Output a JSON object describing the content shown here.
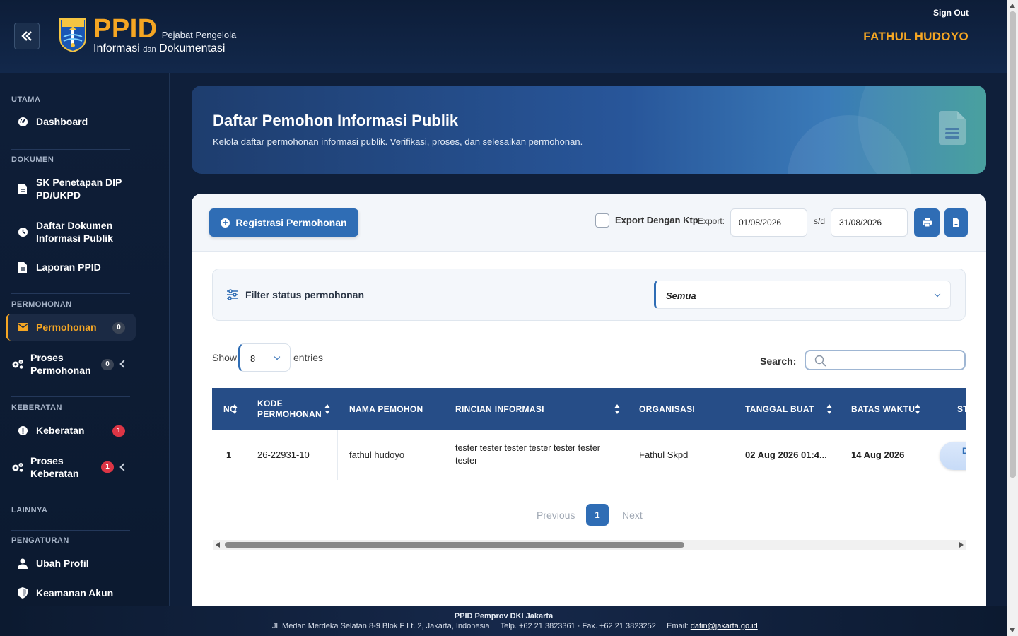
{
  "header": {
    "collapse_icon": "double-chevron-left-icon",
    "logo_ppid": "PPID",
    "logo_sub1": "Pejabat Pengelola",
    "logo_line2_a": "Informasi",
    "logo_line2_b": "dan",
    "logo_line2_c": "Dokumentasi",
    "signout": "Sign Out",
    "username": "FATHUL HUDOYO"
  },
  "sidebar": {
    "sections": {
      "utama": "UTAMA",
      "dokumen": "DOKUMEN",
      "permohonan": "PERMOHONAN",
      "keberatan": "KEBERATAN",
      "lainnya": "LAINNYA",
      "pengaturan": "PENGATURAN"
    },
    "items": {
      "dashboard": "Dashboard",
      "sk_penetapan": "SK Penetapan DIP PD/UKPD",
      "daftar_dokumen": "Daftar Dokumen Informasi Publik",
      "laporan": "Laporan PPID",
      "permohonan": "Permohonan",
      "proses_permohonan": "Proses Permohonan",
      "keberatan": "Keberatan",
      "proses_keberatan": "Proses Keberatan",
      "ubah_profil": "Ubah Profil",
      "keamanan_akun": "Keamanan Akun"
    },
    "badges": {
      "permohonan": "0",
      "proses_permohonan": "0",
      "keberatan": "1",
      "proses_keberatan": "1"
    }
  },
  "hero": {
    "title": "Daftar Pemohon Informasi Publik",
    "subtitle": "Kelola daftar permohonan informasi publik. Verifikasi, proses, dan selesaikan permohonan."
  },
  "toolbar": {
    "register_label": "Registrasi Permohonan",
    "export_ktp_label": "Export Dengan Ktp",
    "export_label": "Export:",
    "date_from": "01/08/2026",
    "date_sep": "s/d",
    "date_to": "31/08/2026"
  },
  "filter": {
    "label": "Filter status permohonan",
    "selected": "Semua"
  },
  "table_controls": {
    "show_label": "Show",
    "page_size": "8",
    "entries_label": "entries",
    "search_label": "Search:",
    "search_value": ""
  },
  "table": {
    "columns": [
      "NO",
      "KODE PERMOHONAN",
      "NAMA PEMOHON",
      "RINCIAN INFORMASI",
      "ORGANISASI",
      "TANGGAL BUAT",
      "BATAS WAKTU",
      "ST"
    ],
    "rows": [
      {
        "no": "1",
        "kode": "26-22931-10",
        "nama": "fathul hudoyo",
        "rincian": "tester tester tester tester tester tester tester",
        "organisasi": "Fathul Skpd",
        "tanggal": "02 Aug 2026 01:4...",
        "batas": "14 Aug 2026",
        "status": "D P"
      }
    ]
  },
  "pagination": {
    "previous": "Previous",
    "current": "1",
    "next": "Next"
  },
  "footer": {
    "title": "PPID Pemprov DKI Jakarta",
    "address": "Jl. Medan Merdeka Selatan 8-9 Blok F Lt. 2, Jakarta, Indonesia",
    "phone": "Telp. +62 21 3823361 · Fax. +62 21 3823252",
    "email_label": "Email:",
    "email": "datin@jakarta.go.id"
  },
  "colors": {
    "accent": "#f5a623",
    "primary": "#2f6db5",
    "header_bg": "#0d1d38",
    "table_head": "#264d87",
    "badge_red": "#dc3545"
  }
}
